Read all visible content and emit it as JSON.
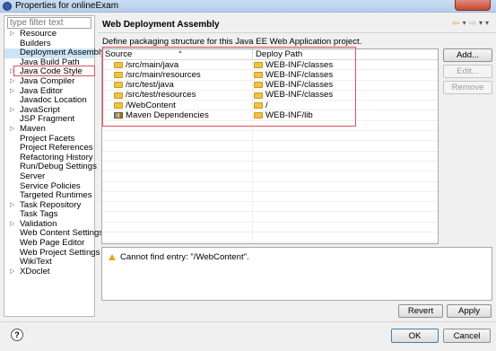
{
  "window": {
    "title": "Properties for onlineExam"
  },
  "filter": {
    "placeholder": "type filter text"
  },
  "tree": [
    {
      "label": "Resource",
      "expandable": true
    },
    {
      "label": "Builders",
      "expandable": false
    },
    {
      "label": "Deployment Assembly",
      "expandable": false,
      "selected": true
    },
    {
      "label": "Java Build Path",
      "expandable": false
    },
    {
      "label": "Java Code Style",
      "expandable": true
    },
    {
      "label": "Java Compiler",
      "expandable": true
    },
    {
      "label": "Java Editor",
      "expandable": true
    },
    {
      "label": "Javadoc Location",
      "expandable": false
    },
    {
      "label": "JavaScript",
      "expandable": true
    },
    {
      "label": "JSP Fragment",
      "expandable": false
    },
    {
      "label": "Maven",
      "expandable": true
    },
    {
      "label": "Project Facets",
      "expandable": false
    },
    {
      "label": "Project References",
      "expandable": false
    },
    {
      "label": "Refactoring History",
      "expandable": false
    },
    {
      "label": "Run/Debug Settings",
      "expandable": false
    },
    {
      "label": "Server",
      "expandable": false
    },
    {
      "label": "Service Policies",
      "expandable": false
    },
    {
      "label": "Targeted Runtimes",
      "expandable": false
    },
    {
      "label": "Task Repository",
      "expandable": true
    },
    {
      "label": "Task Tags",
      "expandable": false
    },
    {
      "label": "Validation",
      "expandable": true
    },
    {
      "label": "Web Content Settings",
      "expandable": false
    },
    {
      "label": "Web Page Editor",
      "expandable": false
    },
    {
      "label": "Web Project Settings",
      "expandable": false
    },
    {
      "label": "WikiText",
      "expandable": false
    },
    {
      "label": "XDoclet",
      "expandable": true
    }
  ],
  "page": {
    "title": "Web Deployment Assembly",
    "description": "Define packaging structure for this Java EE Web Application project."
  },
  "table": {
    "headers": {
      "source": "Source",
      "deploy": "Deploy Path"
    },
    "rows": [
      {
        "source": "/src/main/java",
        "deploy": "WEB-INF/classes",
        "icon": "folder-icon"
      },
      {
        "source": "/src/main/resources",
        "deploy": "WEB-INF/classes",
        "icon": "folder-icon"
      },
      {
        "source": "/src/test/java",
        "deploy": "WEB-INF/classes",
        "icon": "folder-icon"
      },
      {
        "source": "/src/test/resources",
        "deploy": "WEB-INF/classes",
        "icon": "folder-icon"
      },
      {
        "source": "/WebContent",
        "deploy": "/",
        "icon": "folder-icon"
      },
      {
        "source": "Maven Dependencies",
        "deploy": "WEB-INF/lib",
        "icon": "library-icon"
      }
    ],
    "empty_rows": 12
  },
  "buttons": {
    "add": "Add...",
    "edit": "Edit...",
    "remove": "Remove",
    "revert": "Revert",
    "apply": "Apply",
    "ok": "OK",
    "cancel": "Cancel"
  },
  "problems": {
    "message": "Cannot find entry: \"/WebContent\".",
    "icon": "warning-icon"
  },
  "colors": {
    "highlight_border": "#e0505f",
    "selection": "#cde4f7",
    "folder": "#f0c24a",
    "warning": "#e6a817"
  }
}
